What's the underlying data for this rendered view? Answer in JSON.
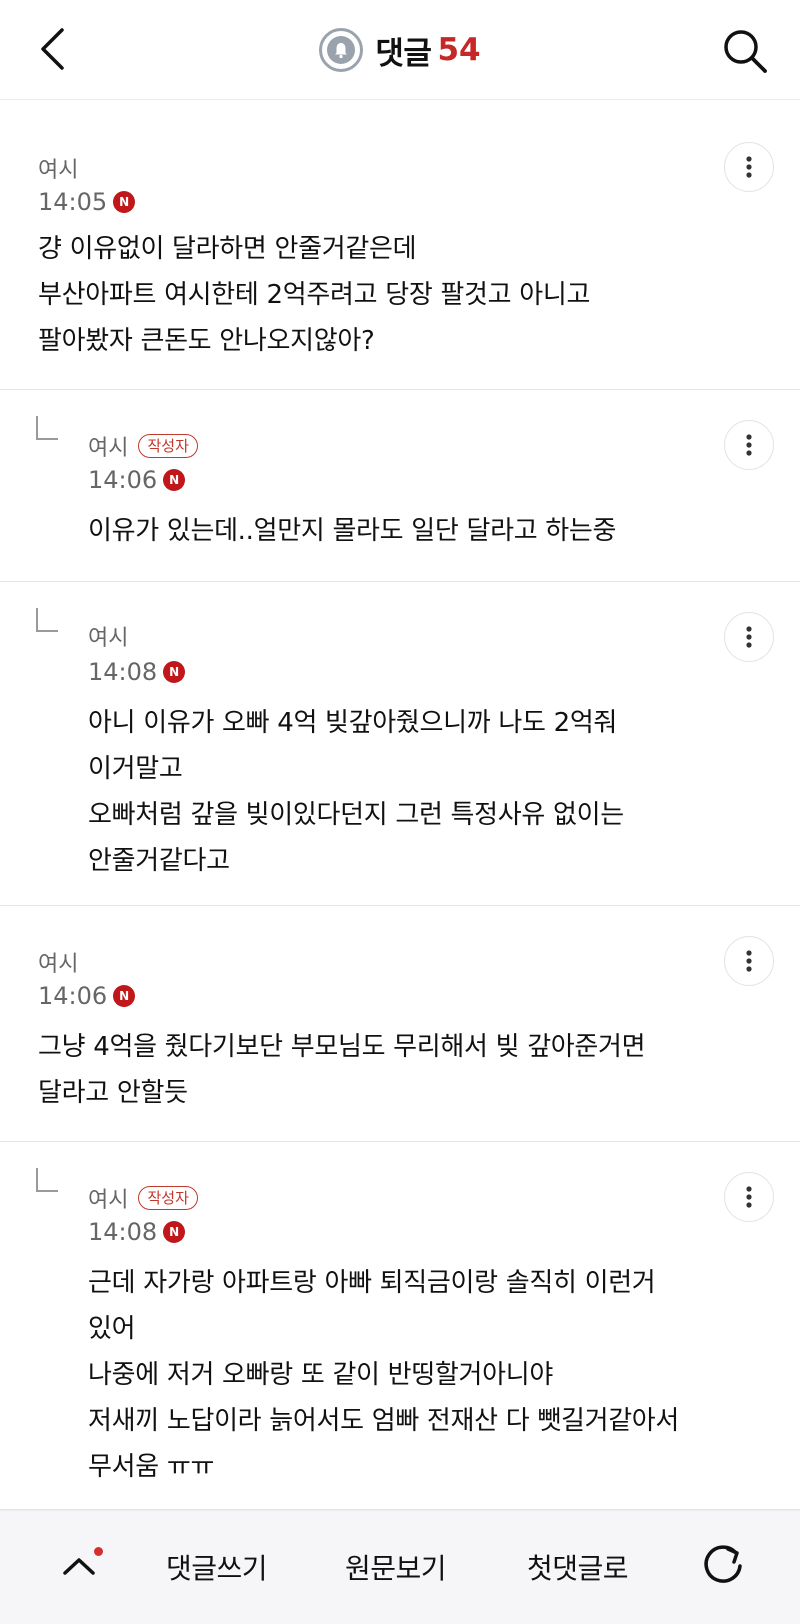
{
  "header": {
    "back_icon": "chevron-left-icon",
    "bell_icon": "bell-icon",
    "title": "댓글",
    "count": "54",
    "search_icon": "search-icon"
  },
  "comments": [
    {
      "author": "여시",
      "badge": "",
      "time": "14:05",
      "n": "N",
      "text": "걍 이유없이 달라하면 안줄거같은데\n부산아파트 여시한테 2억주려고 당장 팔것고 아니고\n팔아봤자 큰돈도 안나오지않아?",
      "reply": false
    },
    {
      "author": "여시",
      "badge": "작성자",
      "time": "14:06",
      "n": "N",
      "text": "이유가 있는데..얼만지 몰라도 일단 달라고 하는중",
      "reply": true
    },
    {
      "author": "여시",
      "badge": "",
      "time": "14:08",
      "n": "N",
      "text": "아니 이유가 오빠 4억 빚갚아줬으니까 나도 2억줘\n이거말고\n오빠처럼 갚을 빚이있다던지 그런 특정사유 없이는\n안줄거같다고",
      "reply": true
    },
    {
      "author": "여시",
      "badge": "",
      "time": "14:06",
      "n": "N",
      "text": "그냥 4억을 줬다기보단 부모님도 무리해서 빚 갚아준거면\n달라고 안할듯",
      "reply": false
    },
    {
      "author": "여시",
      "badge": "작성자",
      "time": "14:08",
      "n": "N",
      "text": "근데 자가랑 아파트랑 아빠 퇴직금이랑 솔직히 이런거\n있어\n나중에 저거 오빠랑 또 같이 반띵할거아니야\n저새끼 노답이라 늙어서도 엄빠 전재산 다 뺏길거같아서\n무서움 ㅠㅠ",
      "reply": true
    }
  ],
  "bottombar": {
    "up_icon": "chevron-up-icon",
    "write": "댓글쓰기",
    "original": "원문보기",
    "first": "첫댓글로",
    "refresh_icon": "refresh-icon"
  },
  "colors": {
    "accent": "#c62828",
    "badge_red": "#c0181a",
    "muted": "#666666"
  }
}
